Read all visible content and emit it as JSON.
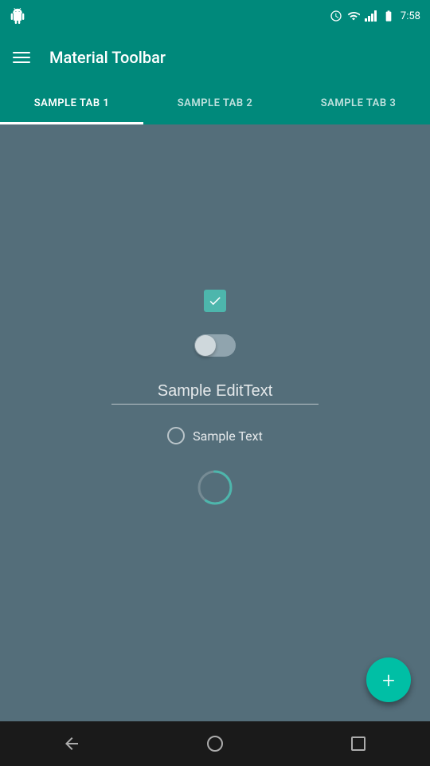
{
  "status_bar": {
    "time": "7:58"
  },
  "toolbar": {
    "title": "Material Toolbar",
    "menu_icon": "☰"
  },
  "tabs": [
    {
      "id": "tab1",
      "label": "SAMPLE TAB 1",
      "active": true
    },
    {
      "id": "tab2",
      "label": "SAMPLE TAB 2",
      "active": false
    },
    {
      "id": "tab3",
      "label": "SAMPLE TAB 3",
      "active": false
    }
  ],
  "content": {
    "checkbox_checked": true,
    "toggle_on": false,
    "edit_text_value": "Sample EditText",
    "radio_label": "Sample Text",
    "fab_label": "+"
  },
  "nav_bar": {
    "back_label": "◁",
    "home_label": "○",
    "recent_label": "□"
  },
  "colors": {
    "teal": "#00897B",
    "teal_accent": "#00BFA5",
    "background": "#546E7A"
  }
}
